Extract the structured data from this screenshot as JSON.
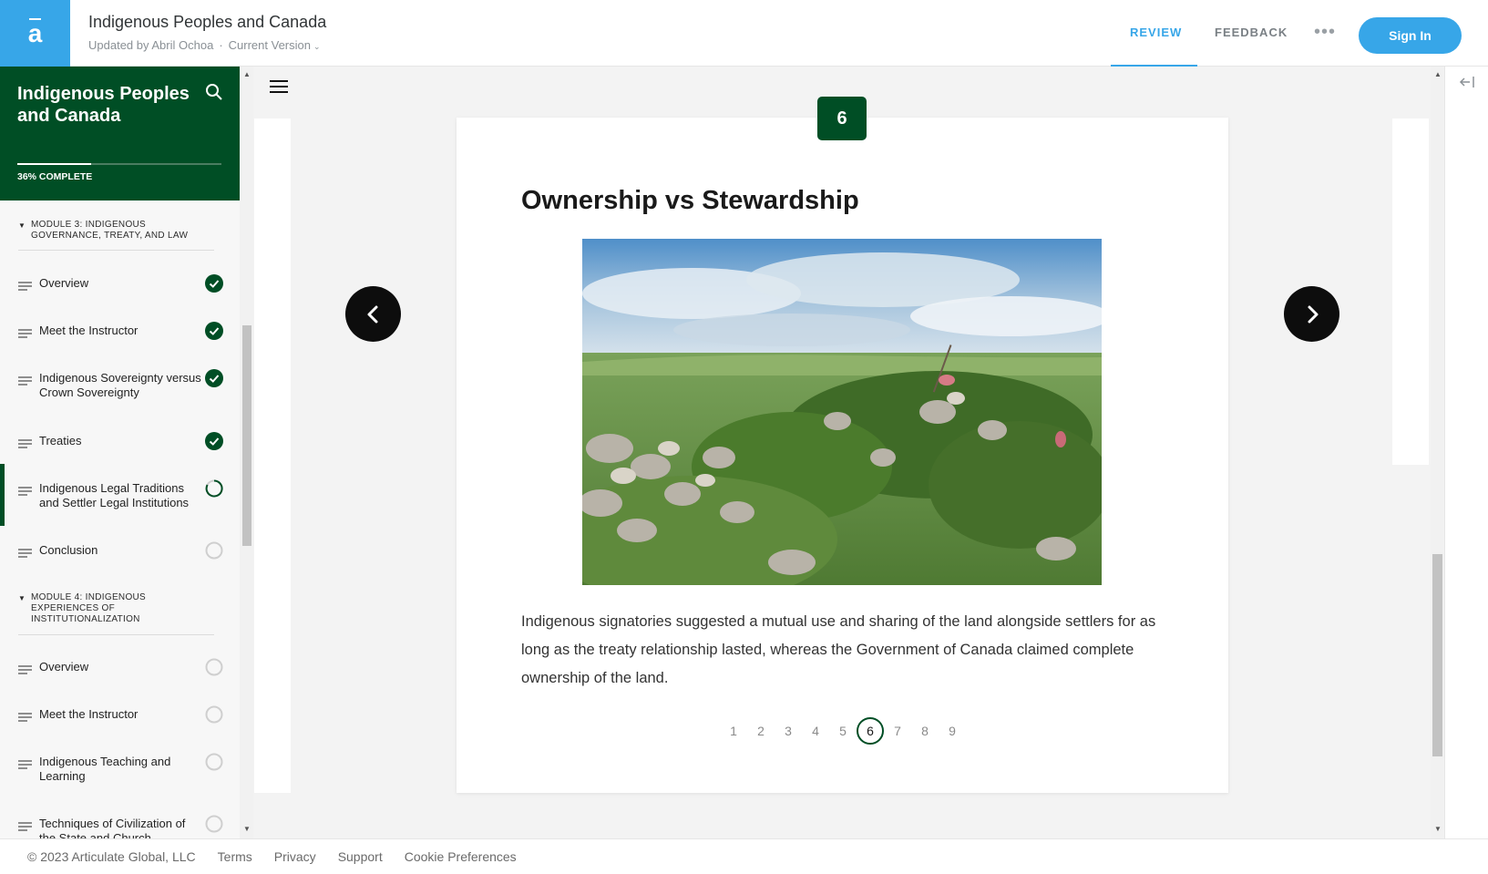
{
  "header": {
    "logo_glyph": "a",
    "title": "Indigenous Peoples and Canada",
    "updated_by": "Updated by Abril Ochoa",
    "separator": "·",
    "version": "Current Version",
    "tabs": {
      "review": "REVIEW",
      "feedback": "FEEDBACK"
    },
    "more": "•••",
    "sign_in": "Sign In",
    "accent": "#37a6e8"
  },
  "sidebar": {
    "course_title": "Indigenous Peoples and Canada",
    "progress_percent": 36,
    "progress_label": "36% COMPLETE",
    "brand_color": "#004e25",
    "modules": [
      {
        "title": "MODULE 3: INDIGENOUS GOVERNANCE, TREATY, AND LAW",
        "lessons": [
          {
            "label": "Overview",
            "status": "complete"
          },
          {
            "label": "Meet the Instructor",
            "status": "complete"
          },
          {
            "label": "Indigenous Sovereignty versus Crown Sovereignty",
            "status": "complete"
          },
          {
            "label": "Treaties",
            "status": "complete"
          },
          {
            "label": "Indigenous Legal Traditions and Settler Legal Institutions",
            "status": "in-progress"
          },
          {
            "label": "Conclusion",
            "status": "not-started"
          }
        ]
      },
      {
        "title": "MODULE 4: INDIGENOUS EXPERIENCES OF INSTITUTIONALIZATION",
        "lessons": [
          {
            "label": "Overview",
            "status": "not-started"
          },
          {
            "label": "Meet the Instructor",
            "status": "not-started"
          },
          {
            "label": "Indigenous Teaching and Learning",
            "status": "not-started"
          },
          {
            "label": "Techniques of Civilization of the State and Church",
            "status": "not-started"
          }
        ]
      }
    ]
  },
  "slide": {
    "number": "6",
    "title": "Ownership vs Stewardship",
    "body": "Indigenous signatories suggested a mutual use and sharing of the land alongside settlers for as long as the treaty relationship lasted, whereas the Government of Canada claimed complete ownership of the land.",
    "pages": [
      "1",
      "2",
      "3",
      "4",
      "5",
      "6",
      "7",
      "8",
      "9"
    ],
    "current_page": "6"
  },
  "footer": {
    "copyright": "© 2023 Articulate Global, LLC",
    "links": [
      "Terms",
      "Privacy",
      "Support",
      "Cookie Preferences"
    ]
  }
}
